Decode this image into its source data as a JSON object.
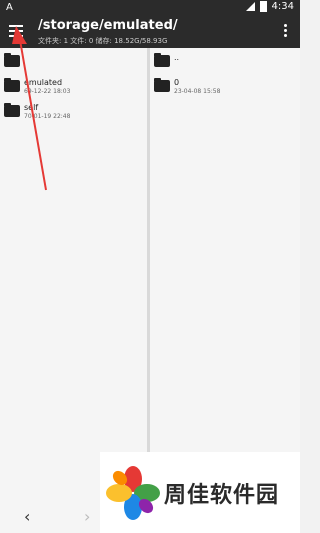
{
  "status_bar": {
    "time": "4:34",
    "left_icon": "A"
  },
  "header": {
    "path": "/storage/emulated/",
    "stats": "文件夹: 1   文件: 0   储存: 18.52G/58.93G"
  },
  "left_panel": {
    "items": [
      {
        "name": "",
        "date": "",
        "icon": "folder-icon"
      },
      {
        "name": "emulated",
        "date": "69-12-22 18:03",
        "icon": "folder-icon"
      },
      {
        "name": "self",
        "date": "70-01-19 22:48",
        "icon": "folder-icon"
      }
    ]
  },
  "right_panel": {
    "items": [
      {
        "name": "..",
        "date": "",
        "icon": "folder-icon"
      },
      {
        "name": "0",
        "date": "23-04-08 15:58",
        "icon": "folder-icon"
      }
    ]
  },
  "nav": {
    "back": "‹",
    "forward": "›"
  },
  "watermark": {
    "text": "周佳软件园"
  },
  "colors": {
    "header_bg": "#2b2b2b",
    "arrow": "#e53935"
  }
}
